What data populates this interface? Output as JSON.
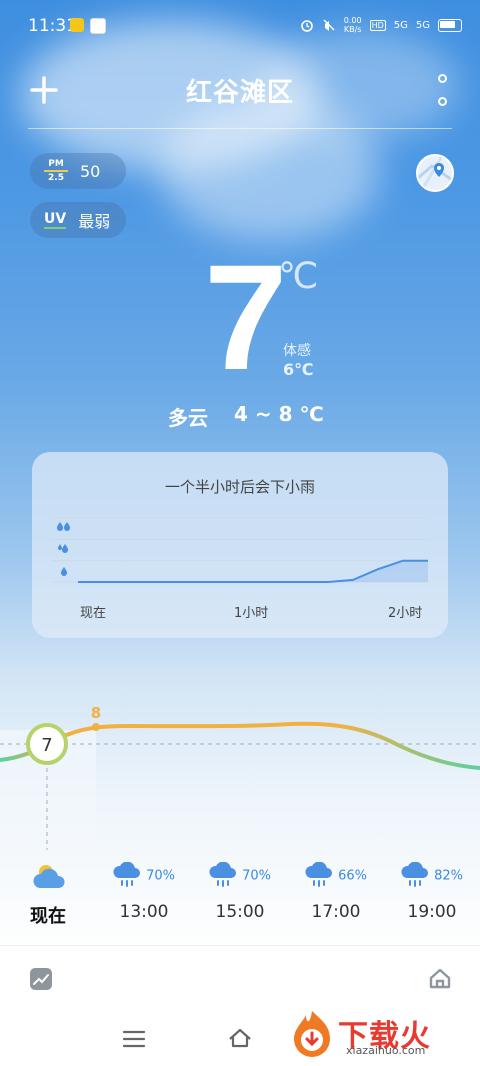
{
  "status_bar": {
    "time": "11:31",
    "net_speed": "0.00",
    "net_unit": "KB/s",
    "hd": "HD",
    "signal_1": "5G",
    "signal_2": "5G"
  },
  "header": {
    "city": "红谷滩区",
    "add_icon": "plus-icon",
    "more_icon": "more-vertical-icon"
  },
  "air": {
    "pm_label_top": "PM",
    "pm_label_bottom": "2.5",
    "pm_value": "50",
    "uv_label": "UV",
    "uv_value": "最弱"
  },
  "current": {
    "temperature": "7",
    "unit": "℃",
    "feels_like_label": "体感",
    "feels_like_value": "6℃",
    "condition": "多云",
    "range": "4 ~ 8 ℃"
  },
  "rain_card": {
    "title": "一个半小时后会下小雨",
    "x_labels": [
      "现在",
      "1小时",
      "2小时"
    ]
  },
  "chart_data": {
    "type": "area",
    "title": "一个半小时后会下小雨",
    "x": [
      "现在",
      "",
      "",
      "",
      "",
      "",
      "",
      "1小时",
      "",
      "",
      "",
      "",
      "",
      "",
      "2小时"
    ],
    "series": [
      {
        "values": [
          0,
          0,
          0,
          0,
          0,
          0,
          0,
          0,
          0,
          0,
          0,
          0.1,
          0.6,
          1,
          1
        ]
      }
    ],
    "ylim": [
      0,
      3
    ],
    "grid": true
  },
  "hourly": {
    "now_temp": "7",
    "high_temp": "8",
    "items": [
      {
        "label": "现在",
        "pct": "",
        "icon": "cloudy-sun-icon"
      },
      {
        "label": "13:00",
        "pct": "70%",
        "icon": "rain-cloud-icon"
      },
      {
        "label": "15:00",
        "pct": "70%",
        "icon": "rain-cloud-icon"
      },
      {
        "label": "17:00",
        "pct": "66%",
        "icon": "rain-cloud-icon"
      },
      {
        "label": "19:00",
        "pct": "82%",
        "icon": "rain-cloud-icon"
      }
    ]
  },
  "watermark": {
    "brand": "下载火",
    "url": "xiazaihuo.com"
  },
  "colors": {
    "accent_blue": "#3a8ae0",
    "temp_orange": "#f3b042",
    "temp_green": "#5cd0a0"
  }
}
